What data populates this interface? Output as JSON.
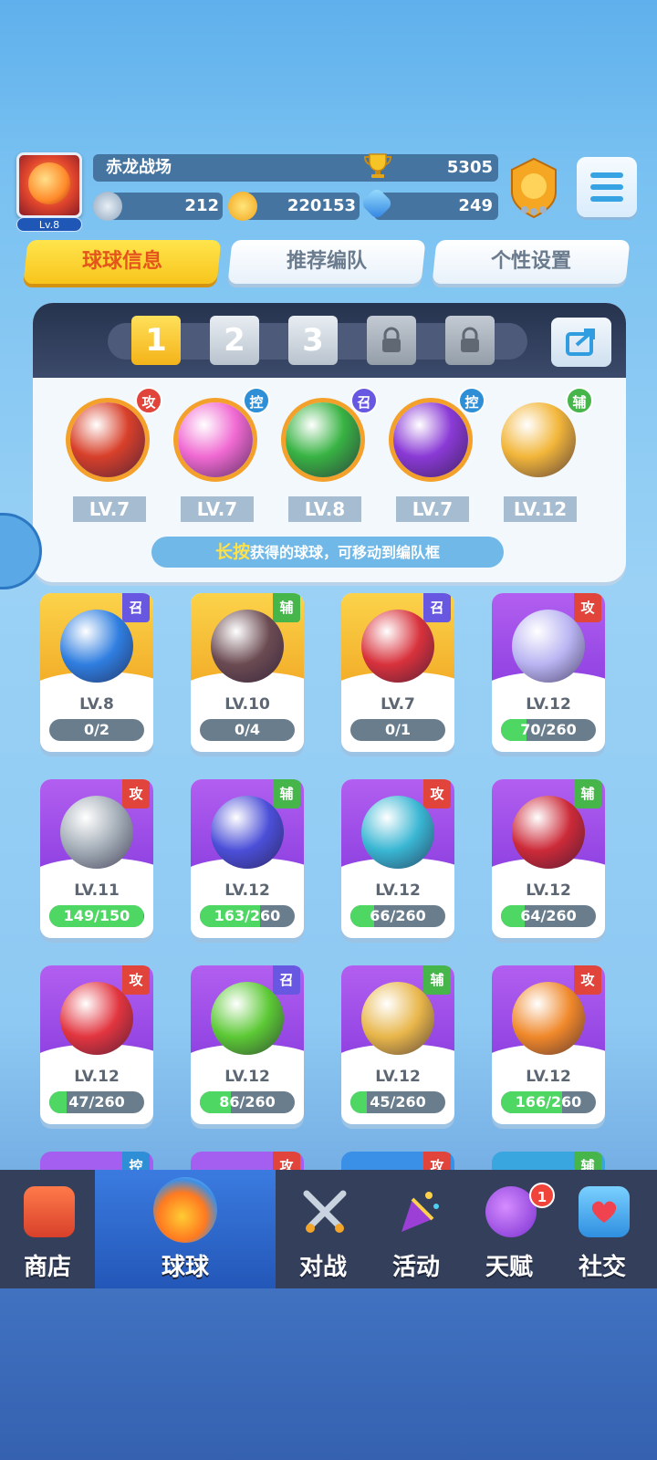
{
  "header": {
    "avatar_level": "Lv.8",
    "arena_name": "赤龙战场",
    "trophies": "5305",
    "resource1": "212",
    "gold": "220153",
    "gems": "249"
  },
  "tabs": [
    "球球信息",
    "推荐编队",
    "个性设置"
  ],
  "team": {
    "slots": [
      "1",
      "2",
      "3"
    ],
    "balls": [
      {
        "type": "攻",
        "level": "LV.7",
        "color": "#d8402a"
      },
      {
        "type": "控",
        "level": "LV.7",
        "color": "#f06ad2"
      },
      {
        "type": "召",
        "level": "LV.8",
        "color": "#38b343"
      },
      {
        "type": "控",
        "level": "LV.7",
        "color": "#8a3ad6"
      },
      {
        "type": "辅",
        "level": "LV.12",
        "color": "#f2b63a"
      }
    ],
    "hint_highlight": "长按",
    "hint_text": "获得的球球，可移动到编队框"
  },
  "cards": [
    {
      "type": "召",
      "level": "LV.8",
      "progress": "0/2",
      "fraction": 0,
      "style": "gold",
      "color": "#2f7ee0"
    },
    {
      "type": "辅",
      "level": "LV.10",
      "progress": "0/4",
      "fraction": 0,
      "style": "gold",
      "color": "#6b4b52"
    },
    {
      "type": "召",
      "level": "LV.7",
      "progress": "0/1",
      "fraction": 0,
      "style": "gold",
      "color": "#d8323c"
    },
    {
      "type": "攻",
      "level": "LV.12",
      "progress": "70/260",
      "fraction": 0.27,
      "style": "purple",
      "color": "#b9b4f2"
    },
    {
      "type": "攻",
      "level": "LV.11",
      "progress": "149/150",
      "fraction": 0.99,
      "style": "purple",
      "color": "#a2acb6"
    },
    {
      "type": "辅",
      "level": "LV.12",
      "progress": "163/260",
      "fraction": 0.63,
      "style": "purple",
      "color": "#4b4fd8"
    },
    {
      "type": "攻",
      "level": "LV.12",
      "progress": "66/260",
      "fraction": 0.25,
      "style": "purple",
      "color": "#39b6d3"
    },
    {
      "type": "辅",
      "level": "LV.12",
      "progress": "64/260",
      "fraction": 0.25,
      "style": "purple",
      "color": "#cc2a38"
    },
    {
      "type": "攻",
      "level": "LV.12",
      "progress": "47/260",
      "fraction": 0.18,
      "style": "purple",
      "color": "#e2353f"
    },
    {
      "type": "召",
      "level": "LV.12",
      "progress": "86/260",
      "fraction": 0.33,
      "style": "purple",
      "color": "#5cc935"
    },
    {
      "type": "辅",
      "level": "LV.12",
      "progress": "45/260",
      "fraction": 0.17,
      "style": "purple",
      "color": "#e8b64a"
    },
    {
      "type": "攻",
      "level": "LV.12",
      "progress": "166/260",
      "fraction": 0.64,
      "style": "purple",
      "color": "#f0882a"
    }
  ],
  "partial_cards": [
    "控",
    "攻",
    "攻",
    "辅"
  ],
  "nav": {
    "items": [
      "商店",
      "球球",
      "对战",
      "活动",
      "天赋",
      "社交"
    ],
    "talent_badge": "1"
  }
}
